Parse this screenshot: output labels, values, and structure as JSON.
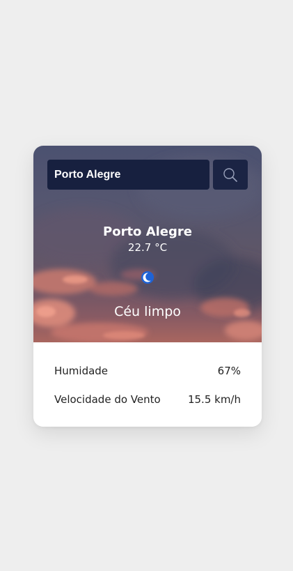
{
  "search": {
    "value": "Porto Alegre",
    "button_icon": "search-icon"
  },
  "weather": {
    "city": "Porto Alegre",
    "temperature": "22.7 °C",
    "icon": "moon-icon",
    "description": "Céu limpo"
  },
  "details": {
    "humidity_label": "Humidade",
    "humidity_value": "67%",
    "wind_label": "Velocidade do Vento",
    "wind_value": "15.5 km/h"
  },
  "colors": {
    "page_background": "#eeeeee",
    "search_background": "#17203f",
    "text_on_image": "#ffffff",
    "icon_accent": "#1e63d6"
  }
}
